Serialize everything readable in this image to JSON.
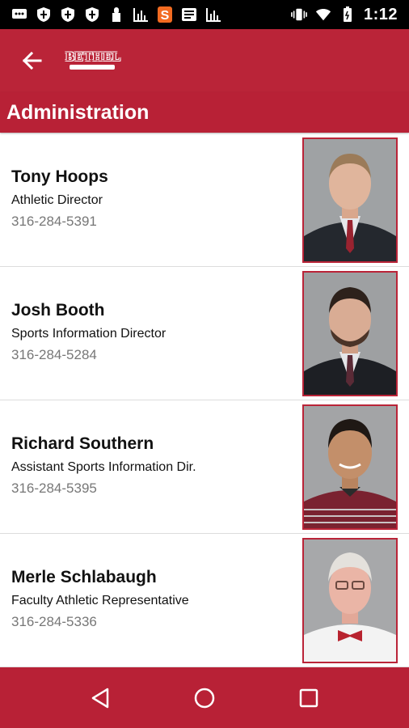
{
  "statusbar": {
    "time": "1:12",
    "left_icons": [
      "message-icon",
      "shield-icon",
      "shield-icon",
      "shield-icon",
      "lock-icon",
      "chart-icon",
      "s-logo-icon",
      "news-icon",
      "chart-icon"
    ],
    "right_icons": [
      "vibrate-icon",
      "wifi-icon",
      "battery-icon"
    ]
  },
  "appbar": {
    "logo_text": "BETHEL",
    "back_icon": "arrow-left-icon",
    "color": "#ba2438"
  },
  "section": {
    "title": "Administration"
  },
  "staff": [
    {
      "name": "Tony Hoops",
      "title": "Athletic Director",
      "phone": "316-284-5391"
    },
    {
      "name": "Josh Booth",
      "title": "Sports Information Director",
      "phone": "316-284-5284"
    },
    {
      "name": "Richard Southern",
      "title": "Assistant Sports Information Dir.",
      "phone": "316-284-5395"
    },
    {
      "name": "Merle  Schlabaugh",
      "title": "Faculty Athletic Representative",
      "phone": "316-284-5336"
    }
  ],
  "navbar": {
    "buttons": [
      "back-triangle-icon",
      "home-circle-icon",
      "recents-square-icon"
    ]
  }
}
